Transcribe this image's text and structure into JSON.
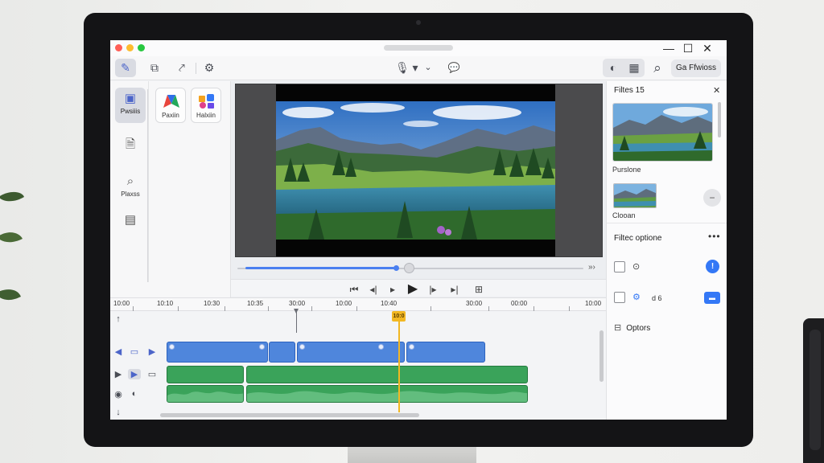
{
  "window": {
    "minimize_glyph": "—",
    "maximize_glyph": "☐",
    "close_glyph": "✕"
  },
  "toolbar": {
    "tools": [
      {
        "name": "edit-tool",
        "icon": "✎"
      },
      {
        "name": "copy-tool",
        "icon": "⧉"
      },
      {
        "name": "link-tool",
        "icon": "⤤"
      },
      {
        "name": "settings-tool",
        "icon": "⚙"
      }
    ],
    "mic_icon": "🎙",
    "dropdown_icon": "▾",
    "chevron_icon": "⌄",
    "chat_icon": "💬",
    "group_icons": [
      "◐",
      "▦"
    ],
    "search_icon": "⌕",
    "action_button_label": "Ga Ffwioss"
  },
  "left_panel": {
    "tools": [
      {
        "label": "Pwsiiis",
        "icon": "▣",
        "active": true
      },
      {
        "label": "",
        "icon": "🗎",
        "active": false
      },
      {
        "label": "Plaxss",
        "icon": "⌕",
        "active": false
      },
      {
        "label": "",
        "icon": "▤",
        "active": false
      }
    ],
    "effects": [
      {
        "label": "Paxiin"
      },
      {
        "label": "Halxiin"
      }
    ]
  },
  "preview": {
    "end_glyph": "»›"
  },
  "transport": {
    "skip_start": "⏮",
    "step_back": "◂|",
    "play_small": "▸",
    "play": "▶",
    "step_forward": "|▸",
    "skip_end": "▸|",
    "fullscreen": "⊞"
  },
  "right_panel": {
    "title": "Filtes 15",
    "close_glyph": "✕",
    "thumbnail_1_caption": "Purslone",
    "thumbnail_2_caption": "Clooan",
    "minus_glyph": "−",
    "filter_options_title": "Filtec optione",
    "more_glyph": "•••",
    "option_1_icon": "⊙",
    "option_2_icon": "⚙",
    "option_2_label": "d 6",
    "info_glyph": "!",
    "tag_glyph": "▬",
    "options_label": "Optors",
    "options_icon": "⊟"
  },
  "timeline": {
    "ticks": [
      "10:00",
      "10:10",
      "10:30",
      "10:35",
      "30:00",
      "10:00",
      "10:40",
      "30:00",
      "00:00",
      "10:00"
    ],
    "playhead_label": "10:0",
    "track_icons": {
      "up": "↑",
      "down": "↓",
      "video_row": [
        "◀",
        "▭",
        "▶"
      ],
      "audio_row": [
        "▶",
        "▶",
        "▭"
      ],
      "audio2_row": [
        "◉",
        "◐"
      ]
    }
  },
  "colors": {
    "accent": "#4a7ff0",
    "video_clip": "#4f86dc",
    "audio_clip": "#3aa35a",
    "playhead": "#f2b722"
  }
}
